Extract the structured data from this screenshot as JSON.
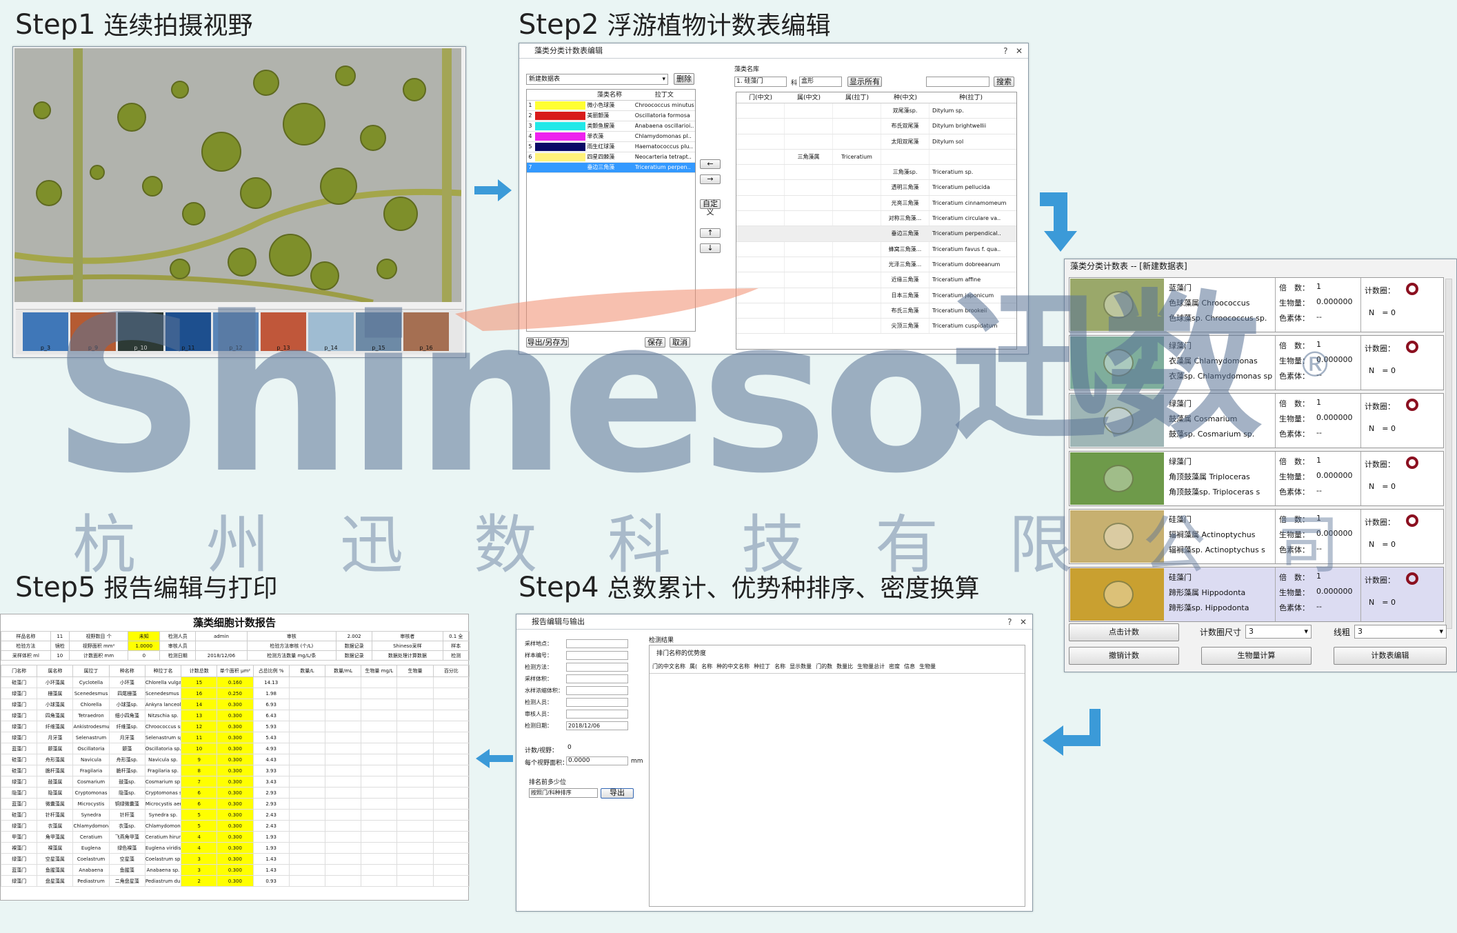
{
  "steps": {
    "s1": {
      "num": "Step1",
      "text": "连续拍摄视野"
    },
    "s2": {
      "num": "Step2",
      "text": "浮游植物计数表编辑"
    },
    "s4": {
      "num": "Step4",
      "text": "总数累计、优势种排序、密度换算"
    },
    "s5": {
      "num": "Step5",
      "text": "报告编辑与打印"
    }
  },
  "watermark": {
    "brand": "Shineso",
    "brand_cn": "迅数",
    "reg": "®",
    "company": "杭州迅数科技有限公司"
  },
  "step1": {
    "thumbs": [
      "p_3",
      "p_9",
      "p_10",
      "p_11",
      "p_12",
      "p_13",
      "p_14",
      "p_15",
      "p_16"
    ]
  },
  "step2": {
    "window_title": "藻类分类计数表编辑",
    "dropdown_value": "新建数据表",
    "delete_btn": "删除",
    "left_headers": [
      "藻类名称",
      "拉丁文"
    ],
    "left_rows": [
      {
        "n": "1",
        "color": "#ffff33",
        "cn": "微小色球藻",
        "latin": "Chroococcus minutus"
      },
      {
        "n": "2",
        "color": "#d81b1b",
        "cn": "美丽颤藻",
        "latin": "Oscillatoria formosa"
      },
      {
        "n": "3",
        "color": "#22e8e8",
        "cn": "类颤鱼腥藻",
        "latin": "Anabaena oscillarioi.."
      },
      {
        "n": "4",
        "color": "#ee22ee",
        "cn": "单衣藻",
        "latin": "Chlamydomonas pl.."
      },
      {
        "n": "5",
        "color": "#0a0a66",
        "cn": "雨生红球藻",
        "latin": "Haematococcus plu.."
      },
      {
        "n": "6",
        "color": "#fff27a",
        "cn": "四星四棘藻",
        "latin": "Neocarteria tetrapt.."
      },
      {
        "n": "7",
        "color": "#3399ff",
        "cn": "垂边三角藻",
        "latin": "Triceratium perpen.."
      }
    ],
    "mid_buttons": [
      "←",
      "→",
      "自定义",
      "↑",
      "↓"
    ],
    "bottom_buttons": [
      "导出/另存为",
      "保存",
      "取消"
    ],
    "right_title": "藻类名库",
    "filter1": "1. 硅藻门",
    "filter_label": "科",
    "filter2": "盒形",
    "show_all": "显示所有",
    "search_btn": "搜索",
    "right_headers": [
      "门(中文)",
      "属(中文)",
      "属(拉丁)",
      "种(中文)",
      "种(拉丁)"
    ],
    "right_rows": [
      {
        "genus_cn": "",
        "genus_la": "",
        "sp_cn": "双尾藻sp.",
        "sp_la": "Ditylum sp."
      },
      {
        "genus_cn": "",
        "genus_la": "",
        "sp_cn": "布氏双尾藻",
        "sp_la": "Ditylum brightwellii"
      },
      {
        "genus_cn": "",
        "genus_la": "",
        "sp_cn": "太阳双尾藻",
        "sp_la": "Ditylum sol"
      },
      {
        "genus_cn": "三角藻属",
        "genus_la": "Triceratium",
        "sp_cn": "",
        "sp_la": ""
      },
      {
        "genus_cn": "",
        "genus_la": "",
        "sp_cn": "三角藻sp.",
        "sp_la": "Triceratium sp."
      },
      {
        "genus_cn": "",
        "genus_la": "",
        "sp_cn": "透明三角藻",
        "sp_la": "Triceratium pellucida"
      },
      {
        "genus_cn": "",
        "genus_la": "",
        "sp_cn": "光亮三角藻",
        "sp_la": "Triceratium cinnamomeum"
      },
      {
        "genus_cn": "",
        "genus_la": "",
        "sp_cn": "对称三角藻...",
        "sp_la": "Triceratium circulare va.."
      },
      {
        "genus_cn": "",
        "genus_la": "",
        "sp_cn": "垂边三角藻",
        "sp_la": "Triceratium perpendical.."
      },
      {
        "genus_cn": "",
        "genus_la": "",
        "sp_cn": "蜂窝三角藻...",
        "sp_la": "Triceratium favus f. qua.."
      },
      {
        "genus_cn": "",
        "genus_la": "",
        "sp_cn": "光泽三角藻...",
        "sp_la": "Triceratium dobreeanum"
      },
      {
        "genus_cn": "",
        "genus_la": "",
        "sp_cn": "近缘三角藻",
        "sp_la": "Triceratium affine"
      },
      {
        "genus_cn": "",
        "genus_la": "",
        "sp_cn": "日本三角藻",
        "sp_la": "Triceratium japonicum"
      },
      {
        "genus_cn": "",
        "genus_la": "",
        "sp_cn": "布氏三角藻",
        "sp_la": "Triceratium brookeii"
      },
      {
        "genus_cn": "",
        "genus_la": "",
        "sp_cn": "尖顶三角藻",
        "sp_la": "Triceratium cuspidatum"
      }
    ]
  },
  "step3": {
    "title": "藻类分类计数表 -- [新建数据表]",
    "labels": {
      "mult": "倍　数：",
      "bio": "生物量：",
      "color": "色素体：",
      "circle": "计数圈：",
      "n": "N　= 0"
    },
    "items": [
      {
        "phylum": "蓝藻门",
        "genus": "色球藻属 Chroococcus",
        "species": "色球藻sp. Chroococcus sp.",
        "mult": "1",
        "bio": "0.000000",
        "color": "--",
        "img": "#9aa86a"
      },
      {
        "phylum": "绿藻门",
        "genus": "衣藻属 Chlamydomonas",
        "species": "衣藻sp. Chlamydomonas sp.",
        "mult": "1",
        "bio": "0.000000",
        "color": "--",
        "img": "#7fae9c"
      },
      {
        "phylum": "绿藻门",
        "genus": "鼓藻属 Cosmarium",
        "species": "鼓藻sp. Cosmarium sp.",
        "mult": "1",
        "bio": "0.000000",
        "color": "--",
        "img": "#9fb6b6"
      },
      {
        "phylum": "绿藻门",
        "genus": "角顶鼓藻属 Triploceras",
        "species": "角顶鼓藻sp. Triploceras s",
        "mult": "1",
        "bio": "0.000000",
        "color": "--",
        "img": "#6e9a4a"
      },
      {
        "phylum": "硅藻门",
        "genus": "辐裥藻属 Actinoptychus",
        "species": "辐裥藻sp. Actinoptychus s",
        "mult": "1",
        "bio": "0.000000",
        "color": "--",
        "img": "#c7b070"
      },
      {
        "phylum": "硅藻门",
        "genus": "蹄形藻属 Hippodonta",
        "species": "蹄形藻sp. Hippodonta",
        "mult": "1",
        "bio": "0.000000",
        "color": "--",
        "img": "#c9a030"
      }
    ],
    "btn_count": "点击计数",
    "btn_undo": "撤销计数",
    "circle_size_label": "计数圈尺寸",
    "circle_size_value": "3",
    "line_label": "线粗",
    "line_value": "3",
    "btn_bio": "生物量计算",
    "btn_edit": "计数表编辑"
  },
  "step4": {
    "title": "报告编辑与输出",
    "fields": [
      "采样地点：",
      "样本编号：",
      "检测方法：",
      "采样体积：",
      "水样浓缩体积：",
      "检测人员：",
      "审核人员：",
      "检测日期："
    ],
    "date_value": "2018/12/06",
    "count_label": "计数/视野：",
    "count_value": "0",
    "area_label": "每个视野面积：",
    "area_value": "0.0000",
    "area_unit": "mm",
    "sort_label": "排名前多少位",
    "sort_value": "按照门/科种排序",
    "sort_btn": "导出",
    "result_title": "检测结果",
    "result_sub": "排门名称的优势度",
    "result_cols": [
      "门的中文名称",
      "属(",
      "名称",
      "种的中文名称",
      "种拉丁",
      "名称",
      "显示数量",
      "门的数",
      "数量比",
      "生物量总计",
      "密度",
      "信息",
      "生物量"
    ]
  },
  "step5": {
    "title": "藻类细胞计数报告",
    "info_rows": [
      [
        "样品名称",
        "11",
        "视野数目 个",
        "未知",
        "检测人员",
        "admin",
        "审核",
        "2.002",
        "审核者",
        "0.1 全"
      ],
      [
        "检验方法",
        "镜检",
        "视野面积 mm²",
        "1.0000",
        "审核人员",
        "",
        "检验方法审核 (个/L)",
        "数据记录",
        "Shineso采样",
        "样本"
      ],
      [
        "采样体积 ml",
        "10",
        "计数面积 mm",
        "0",
        "检测日期",
        "2018/12/06",
        "检测方法数量 mg/L/条",
        "数据记录",
        "数据处理计算数据",
        "检测"
      ]
    ],
    "headers": [
      "门名称",
      "属名称",
      "属拉丁",
      "种名称",
      "种拉丁名",
      "计数总数",
      "单个面积 μm²",
      "占总比例 %",
      "数量/L",
      "数量/mL",
      "生物量 mg/L",
      "生物量",
      "百分比"
    ],
    "rows": [
      [
        "硅藻门",
        "小环藻属",
        "Cyclotella",
        "小环藻",
        "Chlorella vulgaris",
        "15",
        "0.160",
        "14.13"
      ],
      [
        "绿藻门",
        "栅藻属",
        "Scenedesmus",
        "四尾栅藻",
        "Scenedesmus quadricau",
        "16",
        "0.250",
        "1.98"
      ],
      [
        "绿藻门",
        "小球藻属",
        "Chlorella",
        "小球藻sp.",
        "Ankyra lanceolata",
        "14",
        "0.300",
        "6.93"
      ],
      [
        "绿藻门",
        "四角藻属",
        "Tetraedron",
        "细小四角藻",
        "Nitzschia sp.",
        "13",
        "0.300",
        "6.43"
      ],
      [
        "绿藻门",
        "纤维藻属",
        "Ankistrodesmus",
        "纤维藻sp.",
        "Chroococcus sp.",
        "12",
        "0.300",
        "5.93"
      ],
      [
        "绿藻门",
        "月牙藻",
        "Selenastrum",
        "月牙藻",
        "Selenastrum sp.",
        "11",
        "0.300",
        "5.43"
      ],
      [
        "蓝藻门",
        "颤藻属",
        "Oscillatoria",
        "颤藻",
        "Oscillatoria sp.",
        "10",
        "0.300",
        "4.93"
      ],
      [
        "硅藻门",
        "舟形藻属",
        "Navicula",
        "舟形藻sp.",
        "Navicula sp.",
        "9",
        "0.300",
        "4.43"
      ],
      [
        "硅藻门",
        "脆杆藻属",
        "Fragilaria",
        "脆杆藻sp.",
        "Fragilaria sp.",
        "8",
        "0.300",
        "3.93"
      ],
      [
        "绿藻门",
        "鼓藻属",
        "Cosmarium",
        "鼓藻sp.",
        "Cosmarium sp.",
        "7",
        "0.300",
        "3.43"
      ],
      [
        "隐藻门",
        "隐藻属",
        "Cryptomonas",
        "隐藻sp.",
        "Cryptomonas sp.",
        "6",
        "0.300",
        "2.93"
      ],
      [
        "蓝藻门",
        "微囊藻属",
        "Microcystis",
        "铜绿微囊藻",
        "Microcystis aeruginosa",
        "6",
        "0.300",
        "2.93"
      ],
      [
        "硅藻门",
        "针杆藻属",
        "Synedra",
        "针杆藻",
        "Synedra sp.",
        "5",
        "0.300",
        "2.43"
      ],
      [
        "绿藻门",
        "衣藻属",
        "Chlamydomonas",
        "衣藻sp.",
        "Chlamydomonas sp.",
        "5",
        "0.300",
        "2.43"
      ],
      [
        "甲藻门",
        "角甲藻属",
        "Ceratium",
        "飞燕角甲藻",
        "Ceratium hirundinella",
        "4",
        "0.300",
        "1.93"
      ],
      [
        "裸藻门",
        "裸藻属",
        "Euglena",
        "绿色裸藻",
        "Euglena viridis",
        "4",
        "0.300",
        "1.93"
      ],
      [
        "绿藻门",
        "空星藻属",
        "Coelastrum",
        "空星藻",
        "Coelastrum sp.",
        "3",
        "0.300",
        "1.43"
      ],
      [
        "蓝藻门",
        "鱼腥藻属",
        "Anabaena",
        "鱼腥藻",
        "Anabaena sp.",
        "3",
        "0.300",
        "1.43"
      ],
      [
        "绿藻门",
        "盘星藻属",
        "Pediastrum",
        "二角盘星藻",
        "Pediastrum duplex",
        "2",
        "0.300",
        "0.93"
      ]
    ]
  }
}
